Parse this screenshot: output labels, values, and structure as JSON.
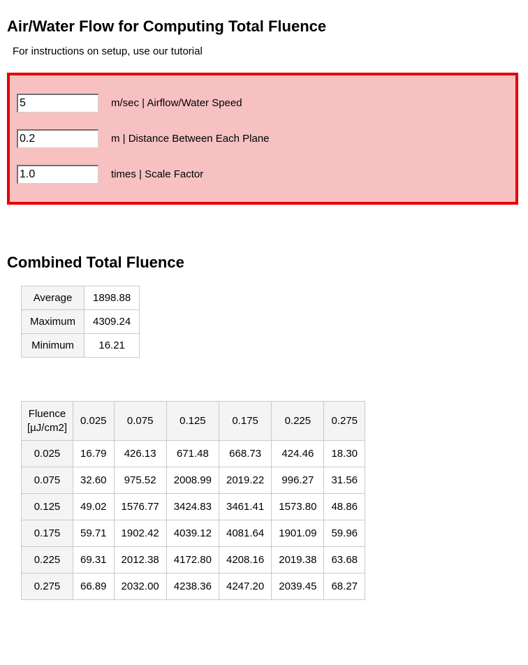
{
  "section1": {
    "title": "Air/Water Flow for Computing Total Fluence",
    "instruction": "For instructions on setup, use our tutorial",
    "inputs": {
      "speed": {
        "value": "5",
        "label": "m/sec | Airflow/Water Speed"
      },
      "distance": {
        "value": "0.2",
        "label": "m | Distance Between Each Plane"
      },
      "scale": {
        "value": "1.0",
        "label": "times | Scale Factor"
      }
    }
  },
  "section2": {
    "title": "Combined Total Fluence",
    "summary": {
      "rows": [
        {
          "label": "Average",
          "value": "1898.88"
        },
        {
          "label": "Maximum",
          "value": "4309.24"
        },
        {
          "label": "Minimum",
          "value": "16.21"
        }
      ]
    },
    "grid": {
      "corner_l1": "Fluence",
      "corner_l2": "[µJ/cm2]",
      "col_headers": [
        "0.025",
        "0.075",
        "0.125",
        "0.175",
        "0.225",
        "0.275"
      ],
      "rows": [
        {
          "h": "0.025",
          "c": [
            "16.79",
            "426.13",
            "671.48",
            "668.73",
            "424.46",
            "18.30"
          ]
        },
        {
          "h": "0.075",
          "c": [
            "32.60",
            "975.52",
            "2008.99",
            "2019.22",
            "996.27",
            "31.56"
          ]
        },
        {
          "h": "0.125",
          "c": [
            "49.02",
            "1576.77",
            "3424.83",
            "3461.41",
            "1573.80",
            "48.86"
          ]
        },
        {
          "h": "0.175",
          "c": [
            "59.71",
            "1902.42",
            "4039.12",
            "4081.64",
            "1901.09",
            "59.96"
          ]
        },
        {
          "h": "0.225",
          "c": [
            "69.31",
            "2012.38",
            "4172.80",
            "4208.16",
            "2019.38",
            "63.68"
          ]
        },
        {
          "h": "0.275",
          "c": [
            "66.89",
            "2032.00",
            "4238.36",
            "4247.20",
            "2039.45",
            "68.27"
          ]
        }
      ]
    }
  }
}
